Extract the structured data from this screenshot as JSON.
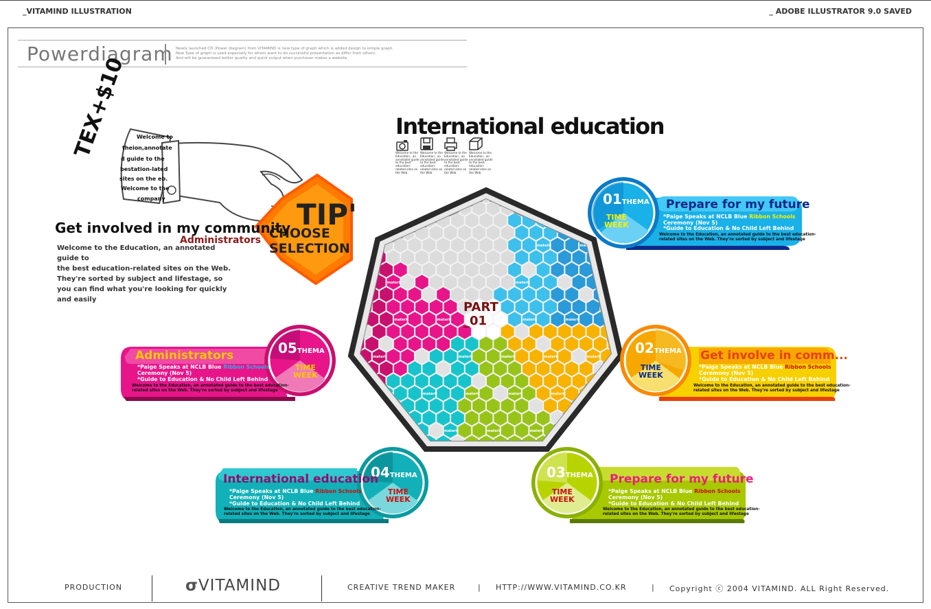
{
  "header": {
    "left": "_VITAMIND ILLUSTRATION",
    "right": "_ ADOBE ILLUSTRATOR 9.0 SAVED"
  },
  "powerdiagram": {
    "title": "Powerdiagram",
    "desc": [
      "Newly launched CD (Power diagram) from VITAMIND is new type of graph which is added design to simple graph.",
      "New Type of graph is used especially for whom want to do successful presentation as differ from others.",
      "And will be guaranteed better quality and quick output when purchaser makes a website."
    ]
  },
  "tex": "TEX+$10",
  "paper_lines": [
    "Welcome to",
    "theion,annotate",
    "d guide to the",
    "bestation-lated",
    "sites on the eb.",
    "Welcome to the",
    "company"
  ],
  "tip": {
    "big": "TIP'",
    "line1": "CHOOSE",
    "line2": "SELECTION"
  },
  "community": {
    "title": "Get involved in my community",
    "sub": "Administrators",
    "body": [
      "Welcome to the Education, an annotated guide to",
      "the best education-related sites on the Web.",
      "They're sorted by subject and lifestage, so",
      "you can find what you're looking for quickly and easily"
    ]
  },
  "center": {
    "title": "International education",
    "icons": [
      {
        "icon": "camera-icon",
        "caption": "Welcome to the Education , an annotated guide to the best education-related sites on the Web."
      },
      {
        "icon": "disk-icon",
        "caption": "Welcome to the Education , an annotated guide to the best education-related sites on the Web."
      },
      {
        "icon": "printer-icon",
        "caption": "Welcome to the Education , an annotated guide to the best education-related sites on the Web."
      },
      {
        "icon": "cube-icon",
        "caption": "Welcome to the Education , an annotated guide to the best education-related sites on the Web."
      }
    ],
    "part": [
      "PART",
      "_01"
    ],
    "material": "material"
  },
  "themes": [
    {
      "num": "01",
      "thema": "THEMA",
      "time": "TIME",
      "week": "WEEK",
      "title": "Prepare for my future",
      "line1a": "*Paige Speaks at NCLB Blue ",
      "line1b": "Ribbon Schools",
      "line2": "Ceremony (Nov 5)",
      "line3": "*Guide to Education & No Child Left Behind",
      "desc1": "Welcome to the Education, an annotated guide to the best education-",
      "desc2": "related sites on the Web. They're sorted by subject and lifestage",
      "color": "#1ab0e8",
      "title_color": "#0a2a8a",
      "accent": "#f5f000"
    },
    {
      "num": "02",
      "thema": "THEMA",
      "time": "TIME",
      "week": "WEEK",
      "title": "Get involve in comm...",
      "line1a": "*Paige Speaks at NCLB Blue ",
      "line1b": "Ribbon Schools",
      "line2": "Ceremony (Nov 5)",
      "line3": "*Guide to Education & No Child Left Behind",
      "desc1": "Welcome to the Education, an annotated guide to the best education-",
      "desc2": "related sites on the Web. They're sorted by subject and lifestage",
      "color": "#f7a800",
      "title_color": "#e8400a",
      "accent": "#c81010"
    },
    {
      "num": "03",
      "thema": "THEMA",
      "time": "TIME",
      "week": "WEEK",
      "title": "Prepare for my future",
      "line1a": "*Paige Speaks at NCLB Blue ",
      "line1b": "Ribbon Schools",
      "line2": "Ceremony (Nov 5)",
      "line3": "*Guide to Education & No Child Left Behind",
      "desc1": "Welcome to the Education, an annotated guide to the best education-",
      "desc2": "related sites on the Web. They're sorted by subject and lifestage",
      "color": "#a8c800",
      "title_color": "#e8207a",
      "accent": "#c81010"
    },
    {
      "num": "04",
      "thema": "THEMA",
      "time": "TIME",
      "week": "WEEK",
      "title": "International education",
      "line1a": "*Paige Speaks at NCLB Blue ",
      "line1b": "Ribbon Schools",
      "line2": "Ceremony (Nov 5)",
      "line3": "*Guide to Education & No Child Left Behind",
      "desc1": "Welcome to the Education, an annotated guide to the best education-",
      "desc2": "related sites on the Web. They're sorted by subject and lifestage",
      "color": "#12b0b8",
      "title_color": "#8a1070",
      "accent": "#c81010"
    },
    {
      "num": "05",
      "thema": "THEMA",
      "time": "TIME",
      "week": "WEEK",
      "title": "Administrators",
      "line1a": "*Paige Speaks at NCLB Blue ",
      "line1b": "Ribbon Schools",
      "line2": "Ceremony (Nov 5)",
      "line3": "*Guide to Education & No Child Left Behind",
      "desc1": "Welcome to the Education, an annotated guide to the best education-",
      "desc2": "related sites on the Web. They're sorted by subject and lifestage",
      "color": "#e8158a",
      "title_color": "#f7c800",
      "accent": "#3aa8e8"
    }
  ],
  "footer": {
    "production": "PRODUCTION",
    "logo": "VITAMIND",
    "tagline": "CREATIVE TREND MAKER",
    "sep": "|",
    "url": "HTTP://WWW.VITAMIND.CO.KR",
    "copyright": "Copyright ⓒ 2004 VITAMIND. ALL Right Reserved."
  }
}
